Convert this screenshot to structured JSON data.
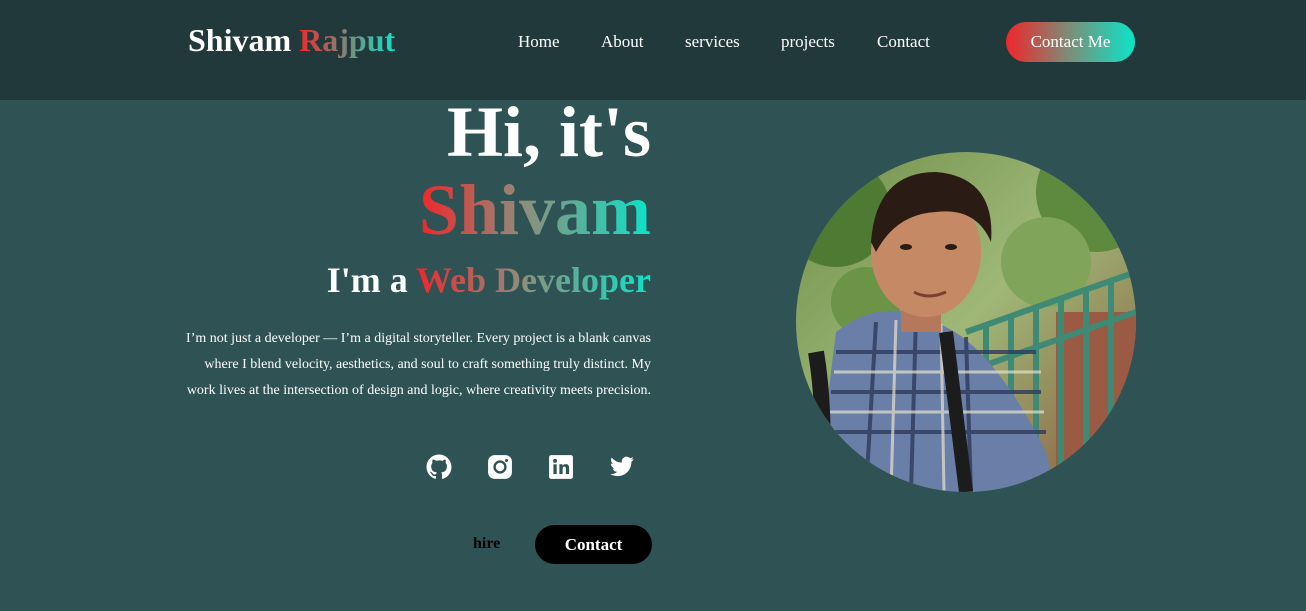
{
  "brand": {
    "first": "Shivam",
    "last": "Rajput"
  },
  "nav": {
    "items": [
      {
        "label": "Home"
      },
      {
        "label": "About"
      },
      {
        "label": "services"
      },
      {
        "label": "projects"
      },
      {
        "label": "Contact"
      }
    ],
    "cta_label": "Contact Me"
  },
  "hero": {
    "greeting": "Hi, it's",
    "name": "Shivam",
    "role_prefix": "I'm a",
    "role_accent": "Web Developer",
    "bio": "I’m not just a developer — I’m a digital storyteller. Every project is a blank canvas where I blend velocity, aesthetics, and soul to craft something truly distinct. My work lives at the intersection of design and logic, where creativity meets precision.",
    "socials": [
      {
        "icon": "github-icon"
      },
      {
        "icon": "instagram-icon"
      },
      {
        "icon": "linkedin-icon"
      },
      {
        "icon": "twitter-icon"
      }
    ],
    "hire_label": "hire",
    "contact_label": "Contact"
  },
  "colors": {
    "nav_bg": "#22393b",
    "page_bg": "#2f5254",
    "accent_start": "#f0262a",
    "accent_end": "#0be4c8"
  }
}
